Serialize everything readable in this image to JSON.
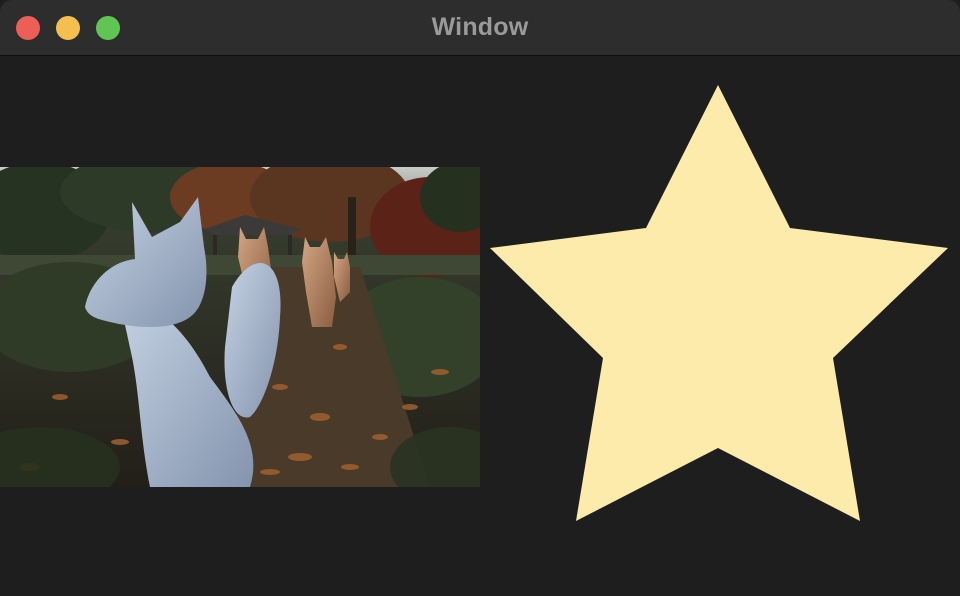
{
  "window": {
    "title": "Window"
  },
  "titlebar": {
    "buttons": [
      {
        "name": "close",
        "color": "#ec5f57"
      },
      {
        "name": "minimize",
        "color": "#f4bf4f"
      },
      {
        "name": "zoom",
        "color": "#61c554"
      }
    ]
  },
  "colors": {
    "titlebar_background": "#2d2d2d",
    "window_background": "#1e1e1e",
    "title_text": "#9a9a9a",
    "star_fill": "#fcebaa"
  },
  "content": {
    "image": {
      "icon": "photo-image"
    },
    "shape": {
      "icon": "star-shape"
    }
  }
}
